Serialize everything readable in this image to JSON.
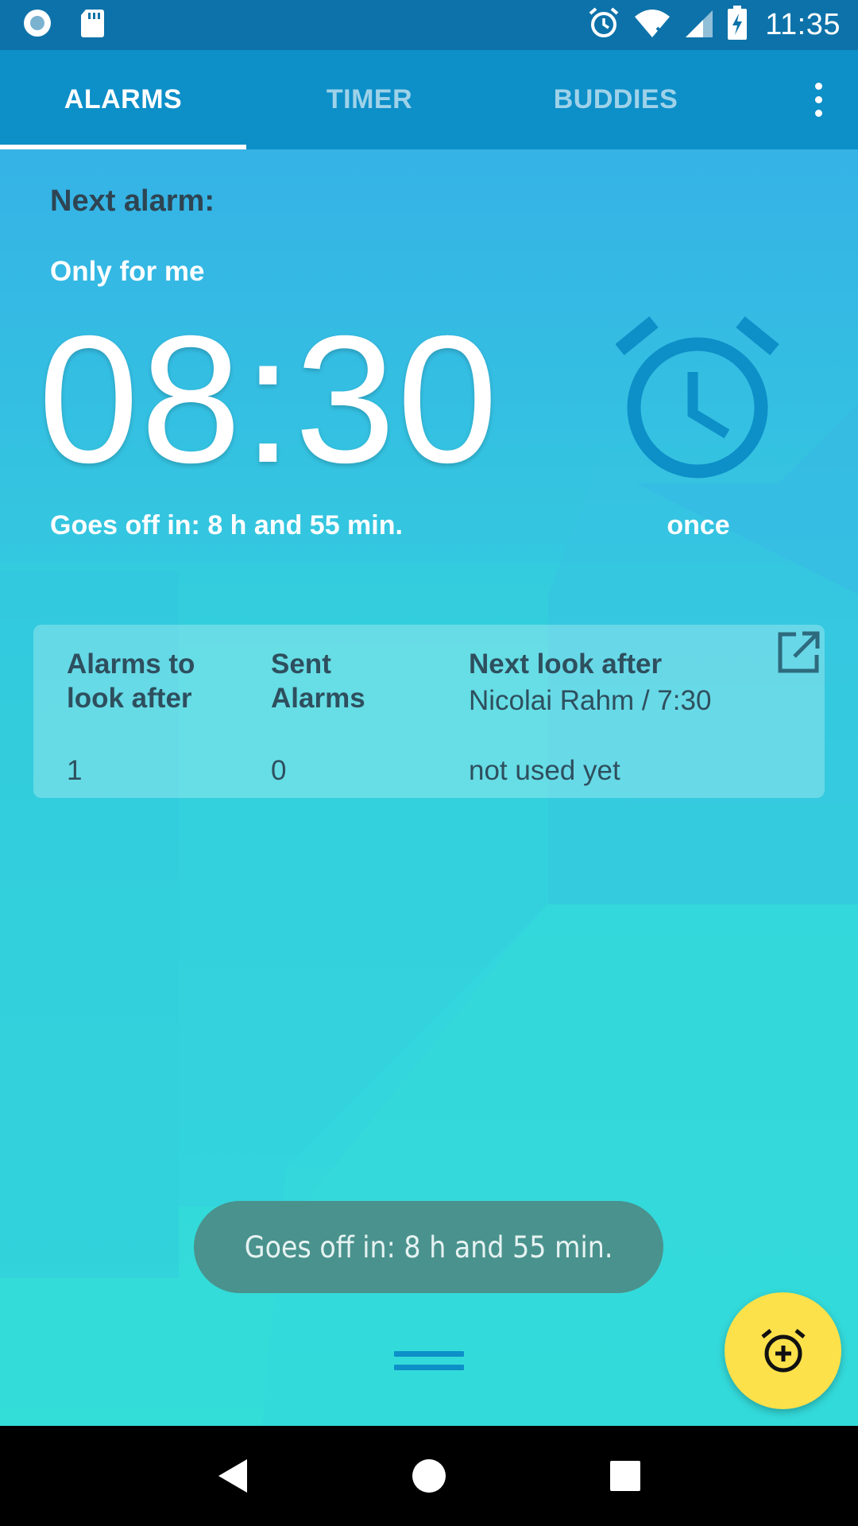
{
  "status_bar": {
    "time": "11:35",
    "icons": [
      "location-circle-icon",
      "sd-card-icon",
      "alarm-icon",
      "wifi-icon",
      "signal-icon",
      "battery-charging-icon"
    ]
  },
  "tabs": [
    {
      "label": "ALARMS",
      "active": true
    },
    {
      "label": "TIMER",
      "active": false
    },
    {
      "label": "BUDDIES",
      "active": false
    }
  ],
  "next_alarm": {
    "heading": "Next alarm:",
    "target": "Only for me",
    "time": "08:30",
    "goes_off": "Goes off in: 8 h and 55 min.",
    "repeat": "once"
  },
  "info_card": {
    "alarms_to_look_after": {
      "label_line1": "Alarms to",
      "label_line2": "look after",
      "value": "1"
    },
    "sent_alarms": {
      "label_line1": "Sent",
      "label_line2": "Alarms",
      "value": "0"
    },
    "next_look_after": {
      "label": "Next look after",
      "detail": "Nicolai Rahm / 7:30",
      "value": "not used yet"
    }
  },
  "toast": {
    "text": "Goes off in: 8 h and 55 min."
  },
  "colors": {
    "status_bar": "#0d72a9",
    "tab_bar": "#0d8fc8",
    "fab": "#fde14a",
    "clock_icon": "#0d8fc8",
    "toast": "#4a928d"
  }
}
